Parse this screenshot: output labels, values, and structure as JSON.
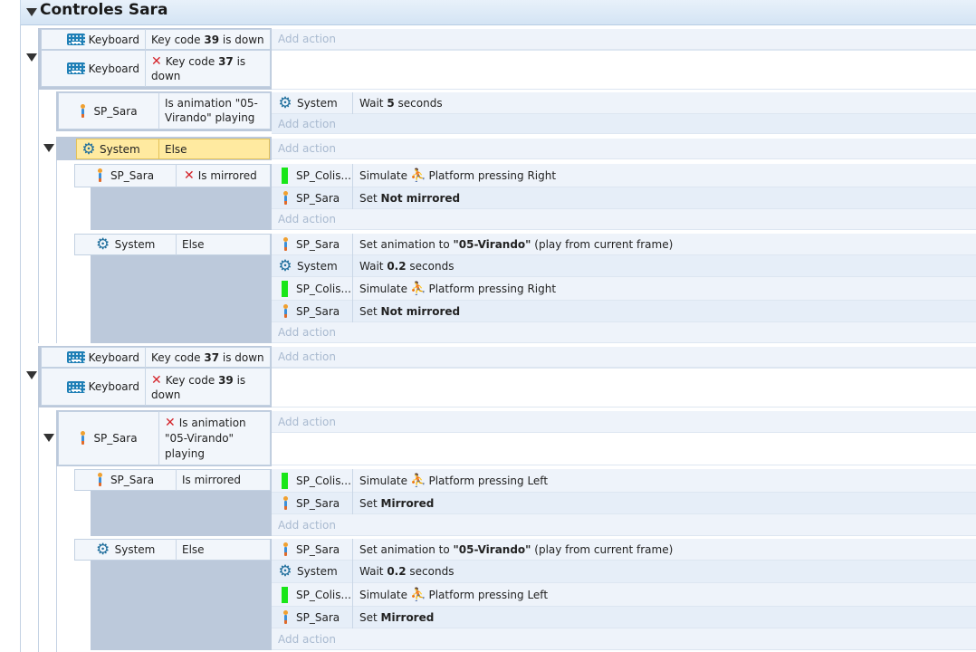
{
  "group": {
    "title": "Controles Sara"
  },
  "common": {
    "add_action": "Add action",
    "keyboard": "Keyboard",
    "system": "System",
    "sp_sara": "SP_Sara",
    "sp_colis": "SP_Colis...",
    "else": "Else",
    "wait": "Wait",
    "seconds": "seconds",
    "simulate": "Simulate",
    "platform_pressing": "Platform pressing",
    "set": "Set",
    "set_animation_to": "Set animation to",
    "anim_name": "\"05-Virando\"",
    "play_from_current": "(play from current frame)",
    "key_code": "Key code",
    "is_down": "is down",
    "is_mirrored": "Is mirrored",
    "is_animation": "Is animation",
    "playing": "playing",
    "not_mirrored": "Not mirrored",
    "mirrored": "Mirrored",
    "right": "Right",
    "left": "Left",
    "anim_cond_1": "Is animation \"05-",
    "anim_cond_2": "Virando\" playing",
    "anim_cond_b": "\"05-Virando\""
  },
  "keycodes": {
    "k39": "39",
    "k37": "37"
  },
  "waits": {
    "w5": "5",
    "w02": "0.2"
  },
  "icons": {
    "keyboard": "keyboard-icon",
    "sprite": "sprite-icon",
    "system": "gear-icon",
    "collision": "collision-box-icon",
    "platform": "platform-runner-icon",
    "invert": "x-invert-icon",
    "expand": "triangle-down-icon"
  },
  "colors": {
    "highlight": "#ffeaa0",
    "header": "#d4e4f4",
    "add_action": "#a9bad0",
    "green": "#19e619"
  }
}
